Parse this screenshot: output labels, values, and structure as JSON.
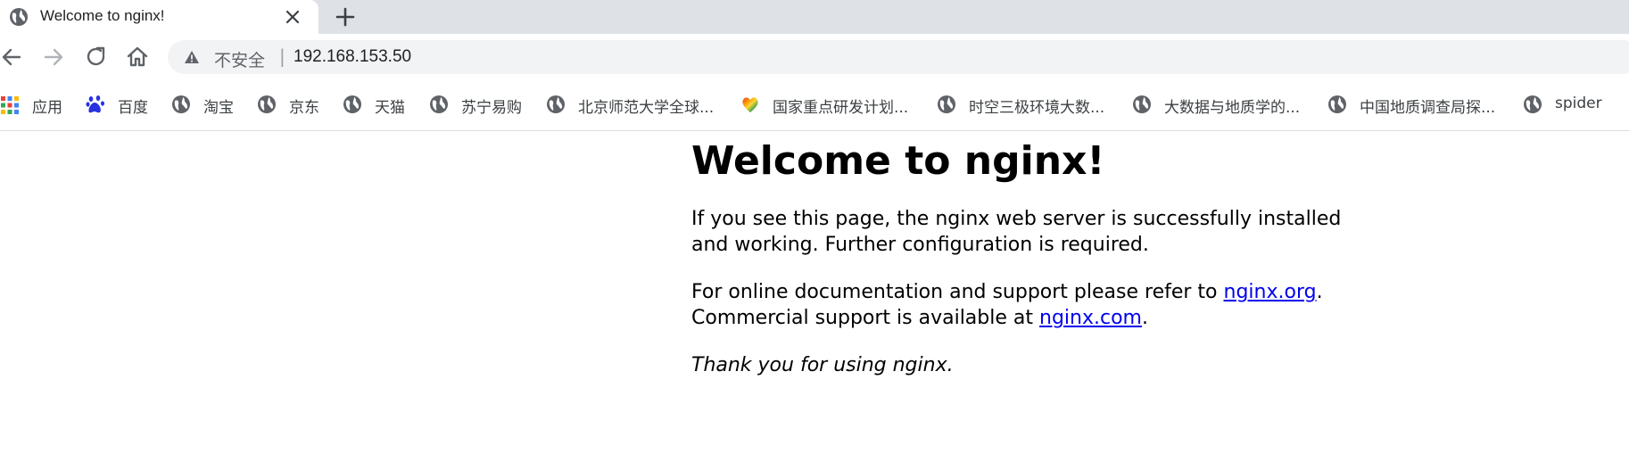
{
  "tab": {
    "title": "Welcome to nginx!",
    "favicon": "globe-icon",
    "close_icon": "close-icon",
    "new_tab_icon": "plus-icon"
  },
  "toolbar": {
    "back_icon": "back-arrow-icon",
    "forward_icon": "forward-arrow-icon",
    "reload_icon": "reload-icon",
    "home_icon": "home-icon",
    "security_icon": "warning-triangle-icon",
    "security_label": "不安全",
    "separator": "|",
    "url": "192.168.153.50"
  },
  "bookmarks": [
    {
      "label": "应用",
      "icon": "apps-grid-icon"
    },
    {
      "label": "百度",
      "icon": "baidu-paw-icon"
    },
    {
      "label": "淘宝",
      "icon": "globe-icon"
    },
    {
      "label": "京东",
      "icon": "globe-icon"
    },
    {
      "label": "天猫",
      "icon": "globe-icon"
    },
    {
      "label": "苏宁易购",
      "icon": "globe-icon"
    },
    {
      "label": "北京师范大学全球...",
      "icon": "globe-icon"
    },
    {
      "label": "国家重点研发计划...",
      "icon": "rainbow-heart-icon"
    },
    {
      "label": "时空三极环境大数...",
      "icon": "globe-icon"
    },
    {
      "label": "大数据与地质学的...",
      "icon": "globe-icon"
    },
    {
      "label": "中国地质调查局探...",
      "icon": "globe-icon"
    },
    {
      "label": "spider",
      "icon": "globe-icon"
    }
  ],
  "page": {
    "heading": "Welcome to nginx!",
    "p1": "If you see this page, the nginx web server is successfully installed and working. Further configuration is required.",
    "p2_before": "For online documentation and support please refer to ",
    "link1": "nginx.org",
    "p2_mid": ".",
    "p2_line2": "Commercial support is available at ",
    "link2": "nginx.com",
    "p2_after": ".",
    "p3": "Thank you for using nginx."
  },
  "colors": {
    "tabstrip_bg": "#dee1e6",
    "omnibox_bg": "#f1f3f4",
    "link": "#0000ee",
    "icon_gray": "#5f6368"
  }
}
